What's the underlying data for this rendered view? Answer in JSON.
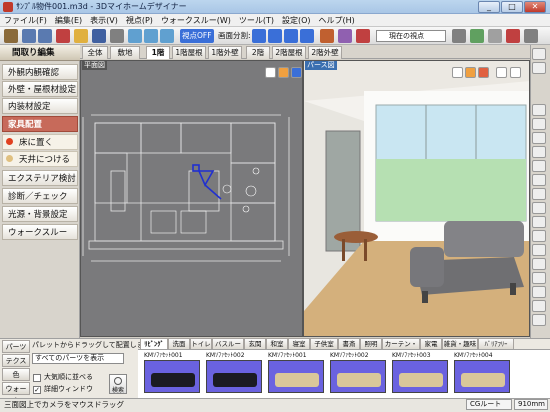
{
  "window": {
    "title": "ｻﾝﾌﾟﾙ物件001.m3d - 3Dマイホームデザイナー",
    "min": "_",
    "max": "□",
    "close": "✕"
  },
  "menu": [
    "ファイル(F)",
    "編集(E)",
    "表示(V)",
    "視点(P)",
    "ウォークスルー(W)",
    "ツール(T)",
    "設定(O)",
    "ヘルプ(H)"
  ],
  "toolbar": {
    "view_btn": "視点OFF",
    "split_label": "画面分割:",
    "viewpoint_combo": "現在の視点"
  },
  "left_panel": {
    "header": "間取り編集",
    "items": [
      "外観内観確認",
      "外壁・屋根材設定",
      "内装材設定",
      "家具配置"
    ],
    "sub_items": [
      "床に置く",
      "天井につける"
    ],
    "items2": [
      "エクステリア検討",
      "診断／チェック",
      "光源・背景設定",
      "ウォークスルー"
    ]
  },
  "floor_tabs": [
    "全体",
    "敷地",
    "1階",
    "1階屋根",
    "1階外壁",
    "2階",
    "2階屋根",
    "2階外壁"
  ],
  "plan_view": {
    "label": "平面図"
  },
  "view3d": {
    "label": "パース図"
  },
  "parts": {
    "side_labels": [
      "パーツ",
      "テクスチャ",
      "色",
      "ウォーク"
    ],
    "hint": "パレットからドラッグして配置します。",
    "select": "すべてのパーツを表示",
    "chk1": "大気順に並べる",
    "chk2": "詳細ウィンドウ",
    "search": "検索",
    "tabs": [
      "ﾘﾋﾞﾝｸﾞ",
      "洗面",
      "トイレ",
      "バスルーム",
      "玄関",
      "和室",
      "寝室",
      "子供室",
      "書斎",
      "照明",
      "カーテン・ラグ",
      "家電",
      "雑貨・趣味",
      "ﾊﾞﾘｱﾌﾘｰ"
    ],
    "items": [
      {
        "name": "KMｿﾌｧｾｯﾄ001",
        "color": "#1b1b22"
      },
      {
        "name": "KMｿﾌｧｾｯﾄ002",
        "color": "#1b1b22"
      },
      {
        "name": "KMｿﾌｧｾｯﾄ001",
        "color": "#d9c79a"
      },
      {
        "name": "KMｿﾌｧｾｯﾄ002",
        "color": "#d9c79a"
      },
      {
        "name": "KMｿﾌｧｾｯﾄ003",
        "color": "#d9c79a"
      },
      {
        "name": "KMｿﾌｧｾｯﾄ004",
        "color": "#d9c79a"
      }
    ]
  },
  "status": {
    "text": "三面図上でカメラをマウスドラッグ",
    "f1": "CGルート",
    "f2": "910mm"
  }
}
